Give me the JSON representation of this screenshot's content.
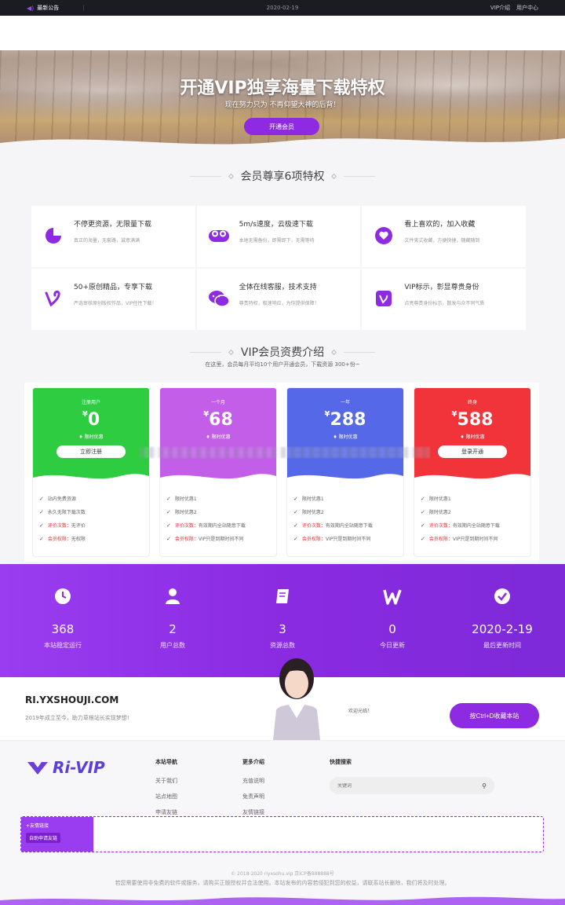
{
  "topbar": {
    "announcement": "最新公告",
    "date": "2020-02-19",
    "links": [
      "VIP介绍",
      "用户中心"
    ]
  },
  "hero": {
    "title": "开通VIP独享海量下载特权",
    "subtitle": "现在努力只为 不再仰望大神的后背！",
    "button": "开通会员"
  },
  "features": {
    "title": "会员尊享6项特权",
    "items": [
      {
        "icon": "pie-chart-icon",
        "title": "不停更资源，无限量下载",
        "desc": "真正的海量，无套路，诚意满满"
      },
      {
        "icon": "cloud-icon",
        "title": "5m/s速度，云极速下载",
        "desc": "本地无需备份，即需即下，无需等待"
      },
      {
        "icon": "heart-icon",
        "title": "看上喜欢的，加入收藏",
        "desc": "文件夹式收藏，方便快捷，随藏随到"
      },
      {
        "icon": "vine-icon",
        "title": "50+原创精品，专享下载",
        "desc": "严选审核原创版权作品，VIP任性下载！"
      },
      {
        "icon": "wechat-icon",
        "title": "全体在线客服，技术支持",
        "desc": "尊贵特权，极速响应，为你提供保障！"
      },
      {
        "icon": "vip-badge-icon",
        "title": "VIP标示，彰显尊贵身份",
        "desc": "点亮尊贵身份标示，散发与众不同气质"
      }
    ]
  },
  "vip": {
    "title": "VIP会员资费介绍",
    "subtitle": "在这里，会员每月平均10个用户开通会员，下载资源 300+份~",
    "plans": [
      {
        "name": "注册用户",
        "currency": "¥",
        "price": "0",
        "tag": "限时优惠",
        "button": "立即注册",
        "color": "#2ecc40",
        "features": [
          {
            "text": "站内免费资源"
          },
          {
            "text": "永久无限下载次数"
          },
          {
            "label": "评价次数：",
            "text": "无评价"
          },
          {
            "label": "会员权限：",
            "text": "无权限"
          }
        ]
      },
      {
        "name": "一个月",
        "currency": "¥",
        "price": "68",
        "tag": "限时优惠",
        "button": "",
        "color": "#c25ee8",
        "features": [
          {
            "text": "限时优惠1"
          },
          {
            "text": "限时优惠2"
          },
          {
            "label": "评价次数：",
            "text": "有效期内全站随意下载"
          },
          {
            "label": "会员权限：",
            "text": "VIP只是到期时间不同"
          }
        ]
      },
      {
        "name": "一年",
        "currency": "¥",
        "price": "288",
        "tag": "限时优惠",
        "button": "",
        "color": "#5468e8",
        "features": [
          {
            "text": "限时优惠1"
          },
          {
            "text": "限时优惠2"
          },
          {
            "label": "评价次数：",
            "text": "有效期内全站随意下载"
          },
          {
            "label": "会员权限：",
            "text": "VIP只是到期时间不同"
          }
        ]
      },
      {
        "name": "终身",
        "currency": "¥",
        "price": "588",
        "tag": "限时优惠",
        "button": "登录开通",
        "color": "#f0343a",
        "features": [
          {
            "text": "限时优惠1"
          },
          {
            "text": "限时优惠2"
          },
          {
            "label": "评价次数：",
            "text": "有效期内全站随意下载"
          },
          {
            "label": "会员权限：",
            "text": "VIP只是到期时间不同"
          }
        ]
      }
    ]
  },
  "stats": [
    {
      "icon": "clock-icon",
      "value": "368",
      "label": "本站稳定运行"
    },
    {
      "icon": "user-icon",
      "value": "2",
      "label": "用户总数"
    },
    {
      "icon": "book-icon",
      "value": "3",
      "label": "资源总数"
    },
    {
      "icon": "w-logo-icon",
      "value": "0",
      "label": "今日更新"
    },
    {
      "icon": "check-circle-icon",
      "value": "2020-2-19",
      "label": "最后更新时间"
    }
  ],
  "promo": {
    "site": "RI.YXSHOUJI.COM",
    "slogan": "2019年成立至今，助力草根站长实现梦想!",
    "hello": "欢迎光临！",
    "button": "按Ctrl+D收藏本站"
  },
  "footer": {
    "logo": "Ri-VIP",
    "columns": [
      {
        "title": "本站导航",
        "links": [
          "关于我们",
          "站点地图",
          "申请友链"
        ]
      },
      {
        "title": "更多介绍",
        "links": [
          "充值说明",
          "免责声明",
          "友情链接"
        ]
      }
    ],
    "search_title": "快捷搜索",
    "search_placeholder": "关键词",
    "friends_label": "+友情链接",
    "friends_apply": "自助申请友链",
    "copyright": "© 2018-2020 riyxsohu.vip 京ICP备888888号",
    "disclaimer": "若您需要使用非免费的软件或服务，请购买正版授权并合法使用。本站发布的内容若侵犯到您的权益，请联系站长删除，我们将及时处理。"
  }
}
